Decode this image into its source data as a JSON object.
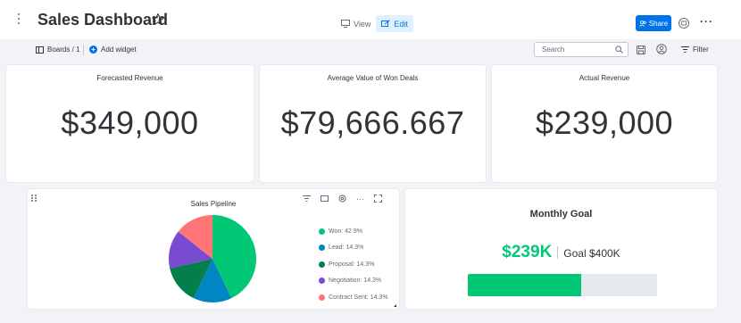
{
  "header": {
    "title": "Sales Dashboard",
    "view_label": "View",
    "edit_label": "Edit",
    "share_label": "Share"
  },
  "toolbar": {
    "boards_label": "Boards / 1",
    "add_widget_label": "Add widget",
    "search_placeholder": "Search",
    "filter_label": "Filter"
  },
  "kpis": [
    {
      "title": "Forecasted Revenue",
      "value": "$349,000"
    },
    {
      "title": "Average Value of Won Deals",
      "value": "$79,666.667"
    },
    {
      "title": "Actual Revenue",
      "value": "$239,000"
    }
  ],
  "pipeline": {
    "title": "Sales Pipeline",
    "legend": [
      {
        "label": "Won: 42.9%",
        "color": "#00c875"
      },
      {
        "label": "Lead: 14.3%",
        "color": "#0086c0"
      },
      {
        "label": "Proposal: 14.3%",
        "color": "#037f4c"
      },
      {
        "label": "Negotiation: 14.3%",
        "color": "#784bd1"
      },
      {
        "label": "Contract Sent: 14.3%",
        "color": "#ff7575"
      }
    ]
  },
  "chart_data": {
    "type": "pie",
    "title": "Sales Pipeline",
    "categories": [
      "Won",
      "Lead",
      "Proposal",
      "Negotiation",
      "Contract Sent"
    ],
    "values": [
      42.9,
      14.3,
      14.3,
      14.3,
      14.3
    ],
    "colors": [
      "#00c875",
      "#0086c0",
      "#037f4c",
      "#784bd1",
      "#ff7575"
    ],
    "legend_position": "right"
  },
  "goal": {
    "title": "Monthly Goal",
    "value": "$239K",
    "target": "Goal $400K",
    "progress": 0.5975,
    "color": "#00c875"
  },
  "colors": {
    "accent": "#0073ea",
    "background": "#f2f3f7"
  }
}
